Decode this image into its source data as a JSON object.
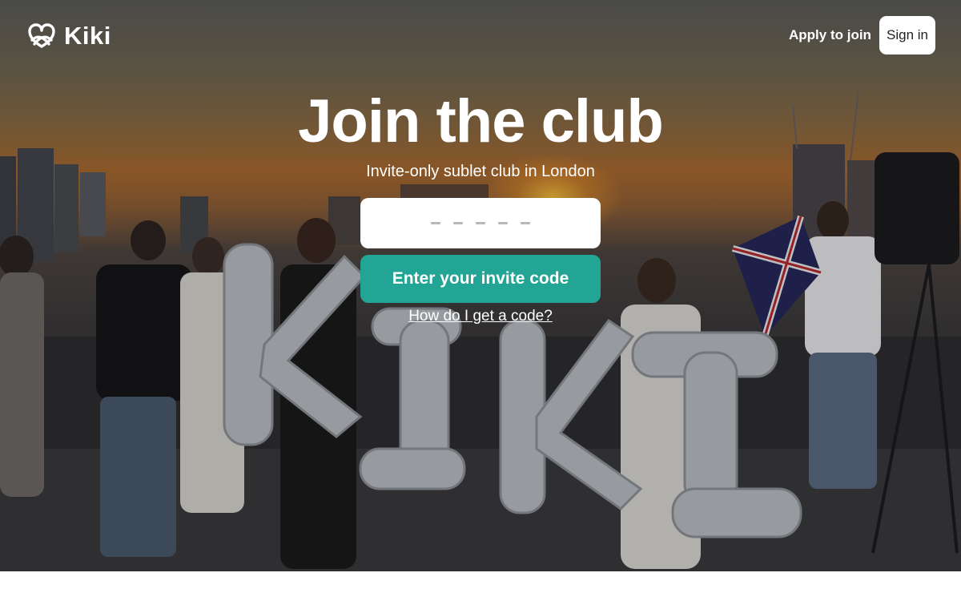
{
  "header": {
    "logo_text": "Kiki",
    "logo_icon": "pretzel-heart-icon",
    "apply_label": "Apply to join",
    "signin_label": "Sign in"
  },
  "hero": {
    "title": "Join the club",
    "subtitle": "Invite-only sublet club in London",
    "code_input": {
      "value": "",
      "placeholder_dashes": 5
    },
    "enter_button_label": "Enter your invite code",
    "help_link": "How do I get a code?"
  },
  "colors": {
    "accent": "#22a594",
    "text_on_image": "#ffffff",
    "button_bg": "#ffffff"
  }
}
